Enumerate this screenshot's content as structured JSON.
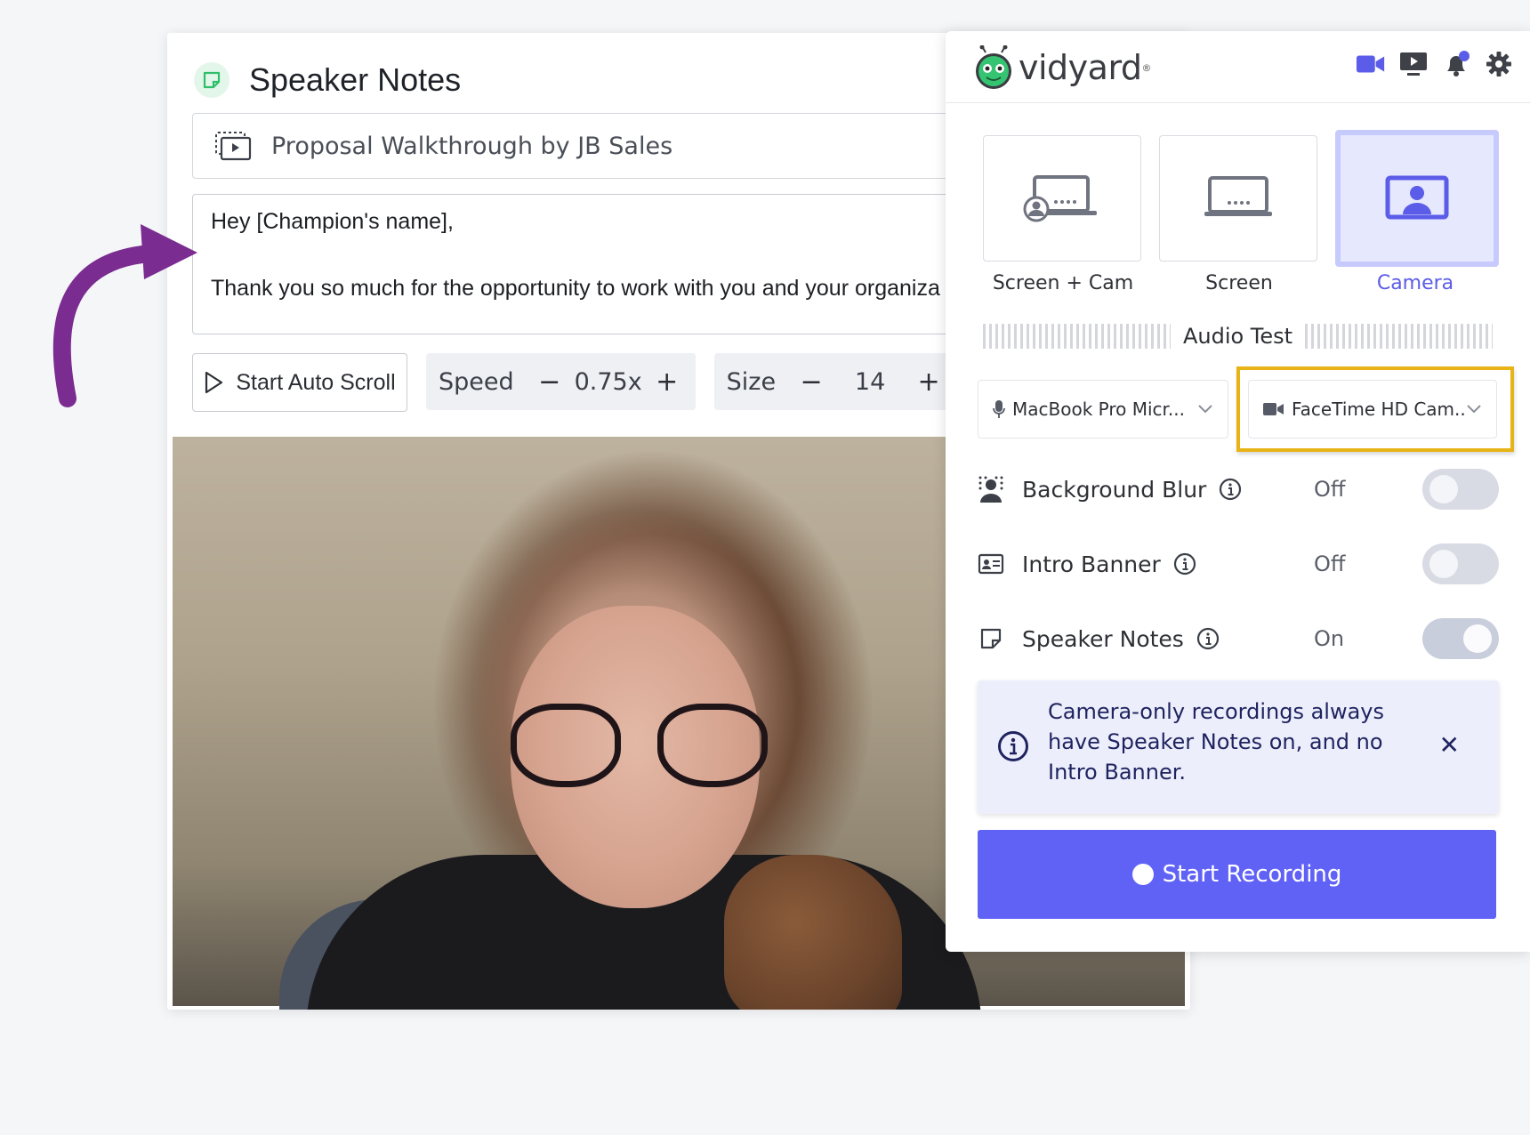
{
  "speaker_notes": {
    "title": "Speaker Notes",
    "video_title": "Proposal Walkthrough by JB Sales",
    "notes_line_1": "Hey [Champion's name],",
    "notes_line_2": "Thank you so much for the opportunity to work with you and your organiza",
    "auto_scroll_label": "Start Auto Scroll",
    "speed": {
      "label": "Speed",
      "value": "0.75x",
      "minus": "−",
      "plus": "+"
    },
    "size": {
      "label": "Size",
      "value": "14",
      "minus": "−",
      "plus": "+"
    }
  },
  "vidyard": {
    "brand": "vidyard",
    "brand_mark": "®",
    "header_icons": [
      "video-camera-icon",
      "screen-share-icon",
      "notification-bell-icon",
      "gear-icon"
    ],
    "modes": [
      {
        "label": "Screen + Cam",
        "icon": "screen-cam-icon",
        "active": false
      },
      {
        "label": "Screen",
        "icon": "screen-icon",
        "active": false
      },
      {
        "label": "Camera",
        "icon": "camera-mode-icon",
        "active": true
      }
    ],
    "audio_test_label": "Audio Test",
    "mic_select": "MacBook Pro Micr...",
    "camera_select": "FaceTime HD Cam...",
    "toggles": [
      {
        "label": "Background Blur",
        "state": "Off",
        "icon": "background-blur-icon"
      },
      {
        "label": "Intro Banner",
        "state": "Off",
        "icon": "intro-banner-icon"
      },
      {
        "label": "Speaker Notes",
        "state": "On",
        "icon": "speaker-notes-icon"
      }
    ],
    "info_banner": "Camera-only recordings always have Speaker Notes on, and no Intro Banner.",
    "close_glyph": "✕",
    "start_recording": "Start Recording"
  },
  "colors": {
    "accent": "#6062f6",
    "active_mode_bg": "#e6e8fe",
    "highlight": "#e8b316",
    "arrow": "#7a2c91"
  }
}
